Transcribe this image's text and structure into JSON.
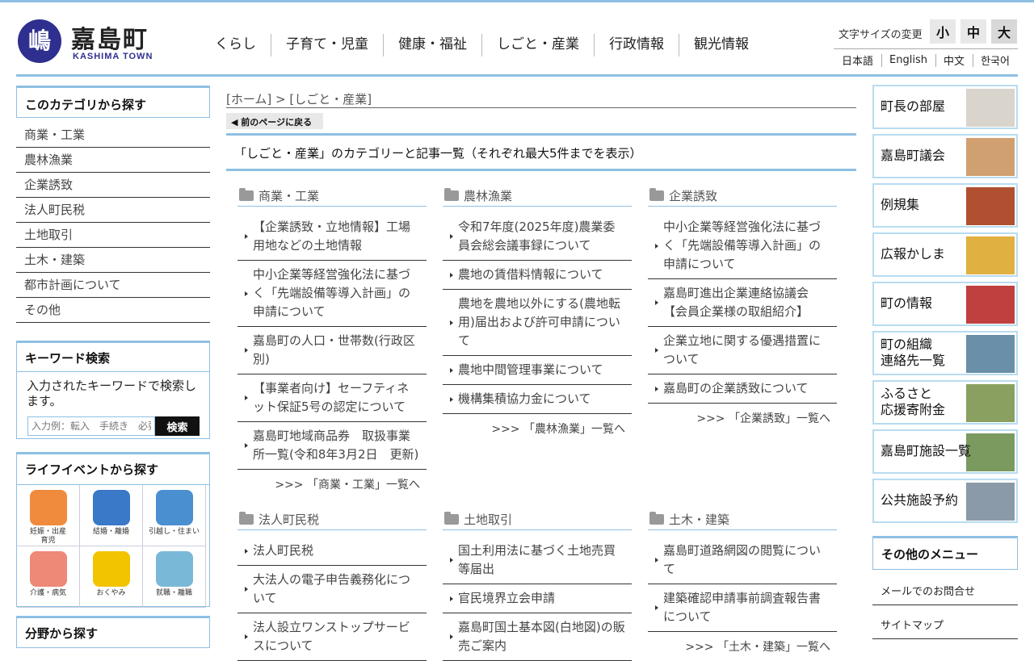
{
  "header": {
    "logo_mark": "嶋",
    "logo_name": "嘉島町",
    "logo_sub": "KASHIMA TOWN",
    "nav": [
      "くらし",
      "子育て・児童",
      "健康・福祉",
      "しごと・産業",
      "行政情報",
      "観光情報"
    ],
    "font_size_label": "文字サイズの変更",
    "font_sizes": [
      "小",
      "中",
      "大"
    ],
    "languages": [
      "日本語",
      "English",
      "中文",
      "한국어"
    ]
  },
  "left": {
    "category_title": "このカテゴリから探す",
    "categories": [
      "商業・工業",
      "農林漁業",
      "企業誘致",
      "法人町民税",
      "土地取引",
      "土木・建築",
      "都市計画について",
      "その他"
    ],
    "keyword": {
      "title": "キーワード検索",
      "desc": "入力されたキーワードで検索します。",
      "placeholder": "入力例：転入　手続き　必要書類",
      "button": "検索"
    },
    "life": {
      "title": "ライフイベントから探す",
      "items": [
        {
          "label": "妊娠・出産\n育児",
          "icon": "pregnancy-icon",
          "color": "#f08a3c"
        },
        {
          "label": "結婚・離婚",
          "icon": "couple-icon",
          "color": "#3a78c8"
        },
        {
          "label": "引越し・住まい",
          "icon": "moving-truck-icon",
          "color": "#4a8fd0"
        },
        {
          "label": "介護・病気",
          "icon": "heart-syringe-icon",
          "color": "#ee8877"
        },
        {
          "label": "おくやみ",
          "icon": "flower-icon",
          "color": "#f2c400"
        },
        {
          "label": "就職・離職",
          "icon": "briefcase-icon",
          "color": "#7ab8d8"
        }
      ]
    },
    "field_title": "分野から探す"
  },
  "main": {
    "breadcrumb": "[ホーム] > [しごと・産業]",
    "back": "前のページに戻る",
    "page_title": "「しごと・産業」のカテゴリーと記事一覧（それぞれ最大5件までを表示）",
    "sections": [
      {
        "title": "商業・工業",
        "articles": [
          "【企業誘致・立地情報】工場用地などの土地情報",
          "中小企業等経営強化法に基づく「先端設備等導入計画」の申請について",
          "嘉島町の人口・世帯数(行政区別)",
          "【事業者向け】セーフティネット保証5号の認定について",
          "嘉島町地域商品券　取扱事業所一覧(令和8年3月2日　更新)"
        ],
        "more": ">>> 「商業・工業」一覧へ"
      },
      {
        "title": "農林漁業",
        "articles": [
          "令和7年度(2025年度)農業委員会総会議事録について",
          "農地の賃借料情報について",
          "農地を農地以外にする(農地転用)届出および許可申請について",
          "農地中間管理事業について",
          "機構集積協力金について"
        ],
        "more": ">>> 「農林漁業」一覧へ"
      },
      {
        "title": "企業誘致",
        "articles": [
          "中小企業等経営強化法に基づく「先端設備等導入計画」の申請について",
          "嘉島町進出企業連絡協議会【会員企業様の取組紹介】",
          "企業立地に関する優遇措置について",
          "嘉島町の企業誘致について"
        ],
        "more": ">>> 「企業誘致」一覧へ"
      },
      {
        "title": "法人町民税",
        "articles": [
          "法人町民税",
          "大法人の電子申告義務化について",
          "法人設立ワンストップサービスについて"
        ],
        "more": ""
      },
      {
        "title": "土地取引",
        "articles": [
          "国土利用法に基づく土地売買等届出",
          "官民境界立会申請",
          "嘉島町国土基本図(白地図)の販売ご案内"
        ],
        "more": ""
      },
      {
        "title": "土木・建築",
        "articles": [
          "嘉島町道路網図の閲覧について",
          "建築確認申請事前調査報告書について"
        ],
        "more": ">>> 「土木・建築」一覧へ"
      }
    ]
  },
  "right": {
    "banners": [
      {
        "label": "町長の部屋",
        "color": "#d9d4cc"
      },
      {
        "label": "嘉島町議会",
        "color": "#d0a070"
      },
      {
        "label": "例規集",
        "color": "#b05030"
      },
      {
        "label": "広報かしま",
        "color": "#e0b040"
      },
      {
        "label": "町の情報",
        "color": "#c04040"
      },
      {
        "label": "町の組織\n連絡先一覧",
        "color": "#6a8fa8"
      },
      {
        "label": "ふるさと\n応援寄附金",
        "color": "#8aa060"
      },
      {
        "label": "嘉島町施設一覧",
        "color": "#7a9a60"
      },
      {
        "label": "公共施設予約",
        "color": "#8a9aa8"
      }
    ],
    "other_title": "その他のメニュー",
    "other_items": [
      "メールでのお問合せ",
      "サイトマップ"
    ]
  }
}
